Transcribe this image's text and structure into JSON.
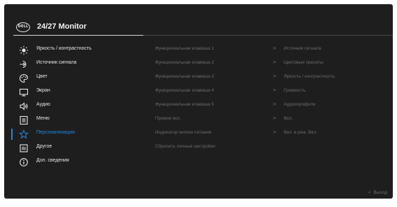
{
  "header": {
    "logo": "DELL",
    "title": "24/27 Monitor"
  },
  "menu": [
    {
      "label": "Яркость / контрастность",
      "icon": "brightness-icon"
    },
    {
      "label": "Источник сигнала",
      "icon": "input-source-icon"
    },
    {
      "label": "Цвет",
      "icon": "color-palette-icon"
    },
    {
      "label": "Экран",
      "icon": "display-icon"
    },
    {
      "label": "Аудио",
      "icon": "speaker-icon"
    },
    {
      "label": "Меню",
      "icon": "menu-icon"
    },
    {
      "label": "Персонализация",
      "icon": "star-icon",
      "active": true
    },
    {
      "label": "Другое",
      "icon": "others-icon"
    },
    {
      "label": "Доп. сведения",
      "icon": "info-icon"
    }
  ],
  "settings": [
    {
      "label": "Функциональная клавиша 1",
      "value": "Источник сигнала"
    },
    {
      "label": "Функциональная клавиша 2",
      "value": "Цветовые пресеты"
    },
    {
      "label": "Функциональная клавиша 3",
      "value": "Яркость / контрастность"
    },
    {
      "label": "Функциональная клавиша 4",
      "value": "Громкость"
    },
    {
      "label": "Функциональная клавиша 5",
      "value": "Аудиопрофили"
    },
    {
      "label": "Прямое вкл.",
      "value": "Вкл."
    },
    {
      "label": "Индикатор кнопки питания",
      "value": "Вкл. в реж. Вкл."
    },
    {
      "label": "Сбросить личные настройки",
      "value": ""
    }
  ],
  "footer": {
    "exit_label": "Выход"
  },
  "colors": {
    "accent": "#1e88e5",
    "background": "#1e1e1e",
    "text": "#e6e6e6",
    "dim_text": "#6b6b6b"
  }
}
